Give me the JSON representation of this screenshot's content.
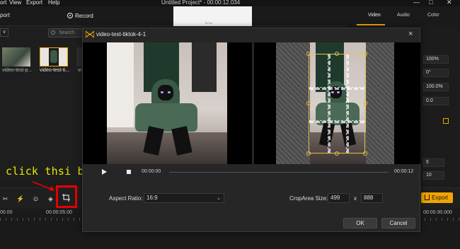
{
  "menu": {
    "items": [
      "ort",
      "View",
      "Export",
      "Help"
    ],
    "title": "Untitled Project* - 00:00:12.034"
  },
  "topbar": {
    "export_label": "port",
    "record_label": "Record"
  },
  "preview": {
    "watermark": "TikTok"
  },
  "right_tabs": [
    "Video",
    "Audio",
    "Color"
  ],
  "media": {
    "search_placeholder": "Search",
    "dropdown_glyph": "∨",
    "items": [
      {
        "label": "video-test-p..."
      },
      {
        "label": "video-test-ti..."
      },
      {
        "label": "vi"
      }
    ]
  },
  "properties": {
    "values": [
      "100%",
      "0°",
      "100.0%",
      "0.0",
      "5",
      "10"
    ]
  },
  "timeline": {
    "export_button": "Export",
    "ruler_labels": [
      "00.00",
      "00:00:05.00",
      "00:00:30.000"
    ]
  },
  "annotation": {
    "text": "click thsi button"
  },
  "modal": {
    "title": "video-test-tiktok-4-1",
    "close": "×",
    "time_current": "00:00:00",
    "time_total": "00:00:12",
    "aspect_ratio_label": "Aspect Ratio:",
    "aspect_ratio_value": "16:9",
    "crop_size_label": "CropArea Size:",
    "crop_width": "499",
    "crop_x": "x",
    "crop_height": "888",
    "ok_label": "OK",
    "cancel_label": "Cancel"
  },
  "colors": {
    "accent": "#f0a500",
    "highlight_box": "#e60000",
    "annotation": "#e8e800"
  }
}
